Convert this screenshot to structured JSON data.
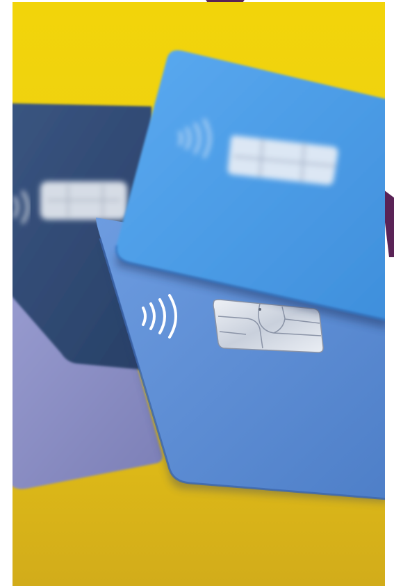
{
  "photo": {
    "subject": "stacked-contactless-chip-payment-cards",
    "alt": ""
  },
  "colors": {
    "background": "#ffffff",
    "accent": "#5a2356",
    "surface_yellow": "#f0d20f",
    "surface_mustard": "#d4b012",
    "card_light_blue": "#4f9fe0",
    "card_mid_blue": "#5c8fd6",
    "card_navy": "#2f4a73",
    "card_lavender": "#8d91c4",
    "chip_silver": "#d8dde6"
  },
  "icons": {
    "contactless": "contactless-icon",
    "chip": "emv-chip-icon"
  }
}
